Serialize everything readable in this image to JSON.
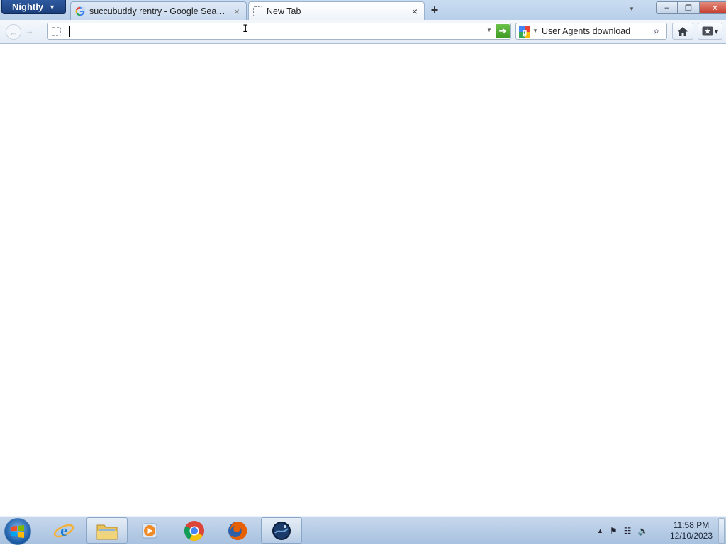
{
  "browser": {
    "app_menu_label": "Nightly",
    "tabs": [
      {
        "title": "succubuddy rentry - Google Search",
        "active": false,
        "icon": "google-g-icon"
      },
      {
        "title": "New Tab",
        "active": true,
        "icon": "blank-page-icon"
      }
    ],
    "new_tab_label": "+",
    "window_buttons": {
      "minimize": "–",
      "maximize": "❐",
      "close": "✕"
    }
  },
  "navbar": {
    "back_icon": "←",
    "forward_icon": "→",
    "url_value": "",
    "url_go_icon": "➔",
    "search": {
      "engine_icon": "google-icon",
      "value": "User Agents download",
      "go_icon": "⌕"
    },
    "home_icon": "home-icon",
    "bookmarks_icon": "bookmarks-icon"
  },
  "taskbar": {
    "apps": [
      {
        "name": "Internet Explorer",
        "icon": "ie-icon"
      },
      {
        "name": "Windows Explorer",
        "icon": "folder-icon"
      },
      {
        "name": "Windows Media Player",
        "icon": "media-player-icon"
      },
      {
        "name": "Google Chrome",
        "icon": "chrome-icon"
      },
      {
        "name": "Firefox",
        "icon": "firefox-icon"
      },
      {
        "name": "Nightly",
        "icon": "nightly-icon"
      }
    ],
    "tray": {
      "up_arrow": "▲",
      "flag": "⚑",
      "network": "☷",
      "volume": "🔈"
    },
    "clock_time": "11:58 PM",
    "clock_date": "12/10/2023"
  },
  "colors": {
    "titlebar": "#c9dcf1",
    "app_menu": "#1b3f7c",
    "go_button": "#3d9a25",
    "taskbar": "#a7c1df"
  }
}
